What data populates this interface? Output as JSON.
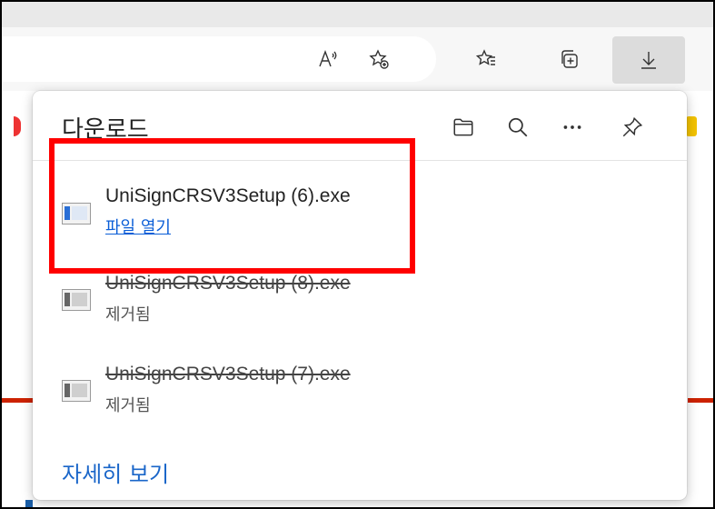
{
  "browser": {
    "toolbar_buttons": [
      {
        "name": "read-aloud-icon"
      },
      {
        "name": "add-favorite-icon"
      },
      {
        "name": "favorites-icon"
      },
      {
        "name": "collections-icon"
      },
      {
        "name": "downloads-icon",
        "active": true
      }
    ]
  },
  "downloads_panel": {
    "title": "다운로드",
    "header_buttons": [
      "open-folder-icon",
      "search-icon",
      "more-options-icon",
      "pin-icon"
    ],
    "items": [
      {
        "file_name": "UniSignCRSV3Setup (6).exe",
        "action_label": "파일 열기",
        "status": "active"
      },
      {
        "file_name": "UniSignCRSV3Setup (8).exe",
        "status_label": "제거됨",
        "status": "removed"
      },
      {
        "file_name": "UniSignCRSV3Setup (7).exe",
        "status_label": "제거됨",
        "status": "removed"
      }
    ],
    "see_more_label": "자세히 보기"
  },
  "colors": {
    "highlight": "#ff0000",
    "link": "#0b5ed7",
    "accent_red": "#cc2200"
  }
}
